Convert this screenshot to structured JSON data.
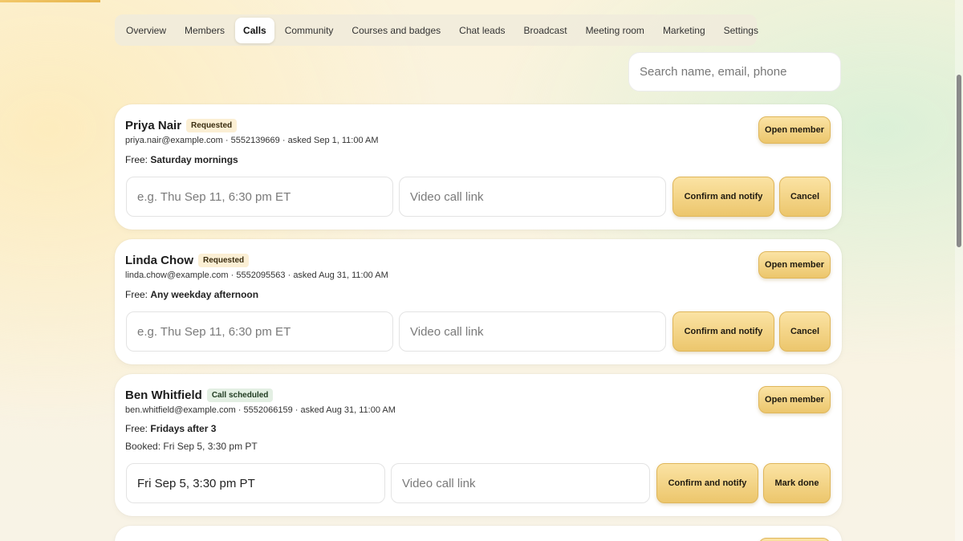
{
  "tabs": [
    {
      "label": "Overview"
    },
    {
      "label": "Members"
    },
    {
      "label": "Calls"
    },
    {
      "label": "Community"
    },
    {
      "label": "Courses and badges"
    },
    {
      "label": "Chat leads"
    },
    {
      "label": "Broadcast"
    },
    {
      "label": "Meeting room"
    },
    {
      "label": "Marketing"
    },
    {
      "label": "Settings"
    }
  ],
  "active_tab": "Calls",
  "search": {
    "placeholder": "Search name, email, phone",
    "value": ""
  },
  "calls": [
    {
      "name": "Priya Nair",
      "status": "Requested",
      "email": "priya.nair@example.com",
      "phone": "5552139669",
      "asked": "asked Sep 1, 11:00 AM",
      "free_label": "Free:",
      "free_value": "Saturday mornings",
      "time_placeholder": "e.g. Thu Sep 11, 6:30 pm ET",
      "time_value": "",
      "link_placeholder": "Video call link",
      "open_label": "Open member",
      "confirm_label": "Confirm and notify",
      "secondary_label": "Cancel"
    },
    {
      "name": "Linda Chow",
      "status": "Requested",
      "email": "linda.chow@example.com",
      "phone": "5552095563",
      "asked": "asked Aug 31, 11:00 AM",
      "free_label": "Free:",
      "free_value": "Any weekday afternoon",
      "time_placeholder": "e.g. Thu Sep 11, 6:30 pm ET",
      "time_value": "",
      "link_placeholder": "Video call link",
      "open_label": "Open member",
      "confirm_label": "Confirm and notify",
      "secondary_label": "Cancel"
    },
    {
      "name": "Ben Whitfield",
      "status": "Call scheduled",
      "email": "ben.whitfield@example.com",
      "phone": "5552066159",
      "asked": "asked Aug 31, 11:00 AM",
      "free_label": "Free:",
      "free_value": "Fridays after 3",
      "booked": "Booked: Fri Sep 5, 3:30 pm PT",
      "time_placeholder": "",
      "time_value": "Fri Sep 5, 3:30 pm PT",
      "link_placeholder": "Video call link",
      "open_label": "Open member",
      "confirm_label": "Confirm and notify",
      "secondary_label": "Mark done"
    }
  ],
  "colors": {
    "accent_gold": "#ecc66c",
    "badge_requested": "#fbefd4",
    "badge_scheduled": "#e3efe3"
  }
}
